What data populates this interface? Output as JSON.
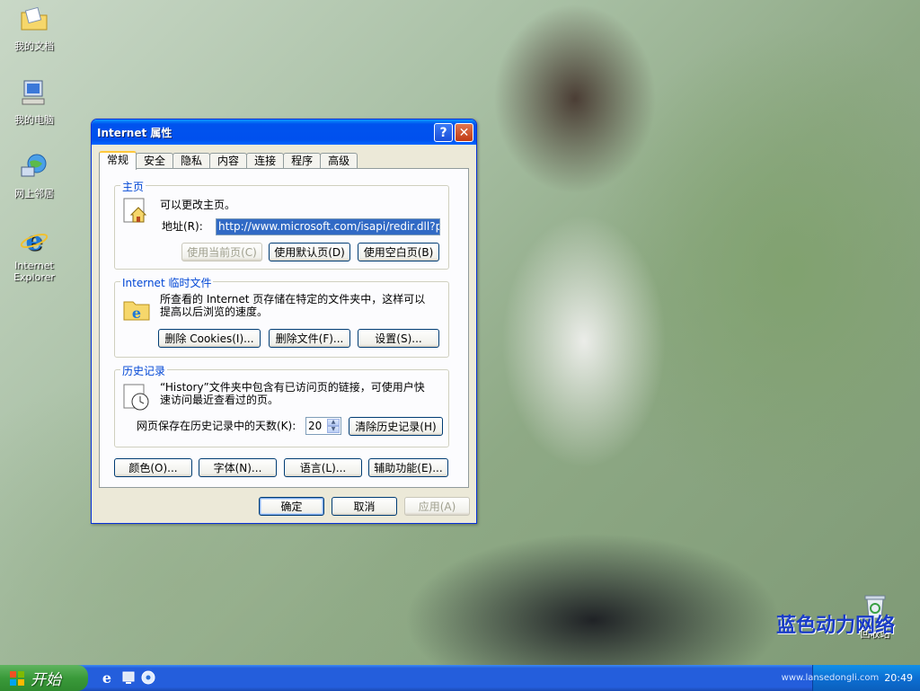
{
  "desktop": {
    "icons": [
      {
        "label": "我的文档"
      },
      {
        "label": "我的电脑"
      },
      {
        "label": "网上邻居"
      },
      {
        "label": "Internet Explorer"
      },
      {
        "label": "回收站"
      }
    ],
    "watermark": "蓝色动力网络",
    "watermark_url": "www.lansedongli.com"
  },
  "taskbar": {
    "start_label": "开始",
    "clock": "20:49"
  },
  "dialog": {
    "title": "Internet 属性",
    "help_glyph": "?",
    "close_glyph": "✕",
    "tabs": [
      {
        "label": "常规",
        "active": true
      },
      {
        "label": "安全"
      },
      {
        "label": "隐私"
      },
      {
        "label": "内容"
      },
      {
        "label": "连接"
      },
      {
        "label": "程序"
      },
      {
        "label": "高级"
      }
    ],
    "home": {
      "group_title": "主页",
      "description": "可以更改主页。",
      "address_label": "地址(R):",
      "address_value": "http://www.microsoft.com/isapi/redir.dll?prd",
      "btn_current": "使用当前页(C)",
      "btn_default": "使用默认页(D)",
      "btn_blank": "使用空白页(B)"
    },
    "temp_files": {
      "group_title": "Internet 临时文件",
      "description_line1": "所查看的 Internet 页存储在特定的文件夹中，这样可以",
      "description_line2": "提高以后浏览的速度。",
      "btn_cookies": "删除 Cookies(I)...",
      "btn_files": "删除文件(F)...",
      "btn_settings": "设置(S)..."
    },
    "history": {
      "group_title": "历史记录",
      "description_line1": "“History”文件夹中包含有已访问页的链接，可使用户快",
      "description_line2": "速访问最近查看过的页。",
      "days_label": "网页保存在历史记录中的天数(K):",
      "days_value": "20",
      "btn_clear": "清除历史记录(H)"
    },
    "bottom_buttons": {
      "colors": "颜色(O)...",
      "fonts": "字体(N)...",
      "languages": "语言(L)...",
      "accessibility": "辅助功能(E)..."
    },
    "footer": {
      "ok": "确定",
      "cancel": "取消",
      "apply": "应用(A)"
    }
  }
}
